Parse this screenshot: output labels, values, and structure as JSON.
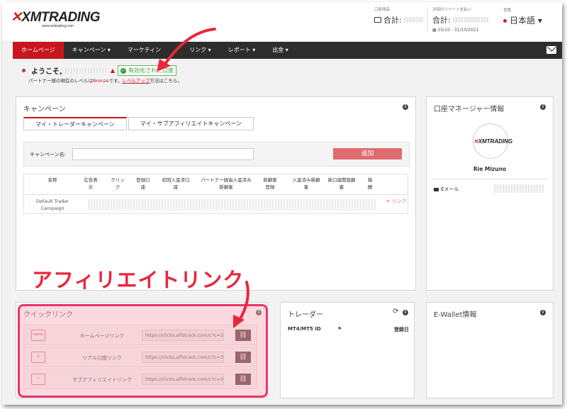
{
  "header": {
    "logo_text": "XMTRADING",
    "logo_sub": "www.xmtrading.com",
    "account_currency_label": "口座残高",
    "account_total": "合計:",
    "rebate_label": "次回のリベート支払い",
    "rebate_total": "合計:",
    "rebate_period": "25/10 - 31/10/2021",
    "language_label": "言語",
    "language_value": "日本語 ▾"
  },
  "nav": {
    "items": [
      "ホームページ",
      "キャンペーン ▾",
      "マーケティン",
      "リンク ▾",
      "レポート ▾",
      "出金 ▾"
    ]
  },
  "welcome": {
    "greeting": "ようこそ,",
    "status": "有効化された口座",
    "level_prefix": "パートナー様の現在のレベルは",
    "level": "Bronze",
    "level_mid": "です。",
    "level_up_link": "レベルアップ",
    "level_suffix": "方法はこちら。"
  },
  "campaign": {
    "title": "キャンペーン",
    "tabs": [
      "マイ・トレーダーキャンペーン",
      "マイ・サブアフィリエイトキャンペーン"
    ],
    "name_label": "キャンペーン名:",
    "add_button": "追加",
    "columns": [
      "名称",
      "広告表示",
      "クリック",
      "登録口座",
      "初回入金済口座",
      "パートナー経由入金済み新顧客",
      "新顧客登録",
      "入金済み新顧客",
      "新口座開設顧客",
      "報酬"
    ],
    "row_name": "Default Trader Campaign",
    "row_link": "リンク"
  },
  "manager": {
    "title": "口座マネージャー情報",
    "avatar_text": "XMTRADING",
    "name": "Rie Mizuno",
    "email_label": "Eメール"
  },
  "quicklink": {
    "title": "クイックリンク",
    "rows": [
      {
        "label": "ホームページリンク",
        "url": "https://clicks.affstrack.com/c?c=3",
        "icon": "www"
      },
      {
        "label": "リアル口座リンク",
        "url": "https://clicks.affstrack.com/c?c=3",
        "icon": "form"
      },
      {
        "label": "サブアフィリエイトリンク",
        "url": "https://clicks.affstrack.com/c?c=3",
        "icon": "people"
      }
    ]
  },
  "trader": {
    "title": "トレーダー",
    "mt_label": "MT4/MT5 ID",
    "reg_date": "登録日"
  },
  "ewallet": {
    "title": "E-Wallet情報"
  },
  "annotation": {
    "label": "アフィリエイトリンク"
  },
  "colors": {
    "brand_red": "#c8161d",
    "nav_bg": "#2d2d2d",
    "annotation_red": "#e8273d",
    "highlight_pink": "#e8356b"
  }
}
